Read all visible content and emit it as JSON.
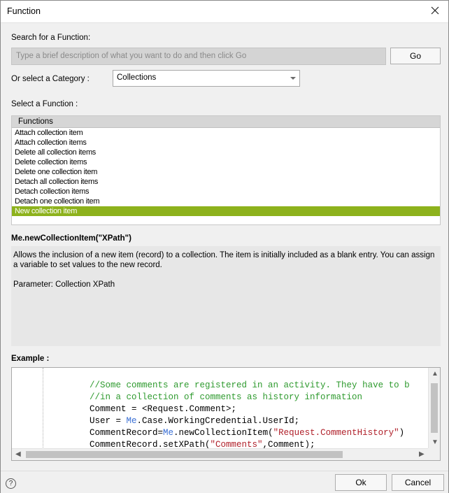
{
  "window": {
    "title": "Function"
  },
  "search": {
    "label": "Search for a Function:",
    "placeholder": "Type a brief description of what you want to do and then click Go",
    "go_label": "Go"
  },
  "category": {
    "label": "Or select a Category :",
    "selected": "Collections"
  },
  "functions": {
    "label": "Select a Function :",
    "header": "Functions",
    "items": [
      "Attach collection item",
      "Attach collection items",
      "Delete all collection items",
      "Delete collection items",
      "Delete one collection item",
      "Detach all collection items",
      "Detach collection items",
      "Detach one collection item",
      "New collection item"
    ],
    "selected_index": 8
  },
  "detail": {
    "signature": "Me.newCollectionItem(\"XPath\")",
    "description_lines": [
      "Allows the inclusion of a new item (record) to a collection. The item is initially included as a blank entry. You can assign",
      "a variable to set values to the new record.",
      "",
      "Parameter: Collection XPath"
    ]
  },
  "example": {
    "label": "Example :",
    "code_lines": [
      [
        {
          "t": "//Some comments are registered in an activity. They have to b",
          "c": "comment"
        }
      ],
      [
        {
          "t": "//in a collection of comments as history information",
          "c": "comment"
        }
      ],
      [
        {
          "t": "Comment = <Request.Comment>;",
          "c": "text"
        }
      ],
      [
        {
          "t": "User = ",
          "c": "text"
        },
        {
          "t": "Me",
          "c": "me"
        },
        {
          "t": ".Case.WorkingCredential.UserId;",
          "c": "text"
        }
      ],
      [
        {
          "t": "CommentRecord=",
          "c": "text"
        },
        {
          "t": "Me",
          "c": "me"
        },
        {
          "t": ".newCollectionItem(",
          "c": "text"
        },
        {
          "t": "\"Request.CommentHistory\"",
          "c": "str"
        },
        {
          "t": ")",
          "c": "text"
        }
      ],
      [
        {
          "t": "CommentRecord.setXPath(",
          "c": "text"
        },
        {
          "t": "\"Comments\"",
          "c": "str"
        },
        {
          "t": ",Comment);",
          "c": "text"
        }
      ]
    ]
  },
  "footer": {
    "ok_label": "Ok",
    "cancel_label": "Cancel",
    "help_glyph": "?"
  },
  "colors": {
    "selection": "#8db21c",
    "comment": "#2e9a2e",
    "keyword": "#3a6fd4",
    "string": "#b0202a"
  },
  "icons": [
    "close-icon",
    "dropdown-caret-icon",
    "help-icon",
    "scroll-up-arrow-icon",
    "scroll-down-arrow-icon",
    "scroll-left-arrow-icon",
    "scroll-right-arrow-icon"
  ]
}
